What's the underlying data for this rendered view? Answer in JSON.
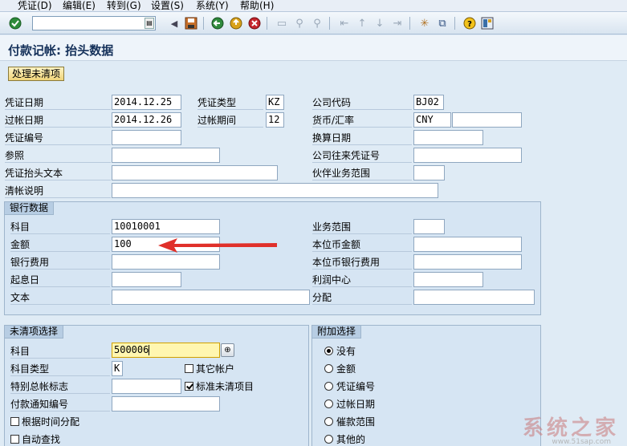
{
  "menu": [
    "凭证(D)",
    "编辑(E)",
    "转到(G)",
    "设置(S)",
    "系统(Y)",
    "帮助(H)"
  ],
  "toolbar": {
    "command_placeholder": "",
    "icons": [
      "enter-icon",
      "save-icon",
      "back-icon",
      "exit-icon",
      "cancel-icon",
      "print-icon",
      "find-icon",
      "find-next-icon",
      "first-page-icon",
      "prev-page-icon",
      "next-page-icon",
      "last-page-icon",
      "new-session-icon",
      "shortcut-icon",
      "help-icon",
      "customize-layout-icon"
    ]
  },
  "title": "付款记帐: 抬头数据",
  "app_button": "处理未清项",
  "header": {
    "doc_date_label": "凭证日期",
    "doc_date": "2014.12.25",
    "doc_type_label": "凭证类型",
    "doc_type": "KZ",
    "company_code_label": "公司代码",
    "company_code": "BJ02",
    "posting_date_label": "过帐日期",
    "posting_date": "2014.12.26",
    "period_label": "过帐期间",
    "period": "12",
    "currency_label": "货币/汇率",
    "currency": "CNY",
    "rate": "",
    "doc_number_label": "凭证编号",
    "doc_number": "",
    "translation_date_label": "换算日期",
    "translation_date": "",
    "reference_label": "参照",
    "reference": "",
    "intercompany_label": "公司往来凭证号",
    "intercompany": "",
    "header_text_label": "凭证抬头文本",
    "header_text": "",
    "trading_partner_label": "伙伴业务范围",
    "trading_partner": "",
    "clearing_text_label": "清帐说明",
    "clearing_text": ""
  },
  "bank": {
    "title": "银行数据",
    "account_label": "科目",
    "account": "10010001",
    "business_area_label": "业务范围",
    "business_area": "",
    "amount_label": "金额",
    "amount": "100",
    "local_amount_label": "本位币金额",
    "local_amount": "",
    "bank_charges_label": "银行费用",
    "bank_charges": "",
    "local_bank_charges_label": "本位币银行费用",
    "local_bank_charges": "",
    "value_date_label": "起息日",
    "value_date": "",
    "profit_center_label": "利润中心",
    "profit_center": "",
    "text_label": "文本",
    "text": "",
    "assignment_label": "分配",
    "assignment": ""
  },
  "open_items": {
    "title": "未清项选择",
    "account_label": "科目",
    "account": "500006",
    "account_type_label": "科目类型",
    "account_type": "K",
    "other_accounts_label": "其它帐户",
    "other_accounts": false,
    "special_gl_label": "特别总帐标志",
    "special_gl": "",
    "standard_oi_label": "标准未清项目",
    "standard_oi": true,
    "payment_advice_label": "付款通知编号",
    "payment_advice": "",
    "distribute_by_age_label": "根据时间分配",
    "distribute_by_age": false,
    "auto_search_label": "自动查找",
    "auto_search": false
  },
  "additional": {
    "title": "附加选择",
    "options": [
      "没有",
      "金额",
      "凭证编号",
      "过帐日期",
      "催款范围",
      "其他的"
    ],
    "selected": "没有"
  },
  "watermark": "系统之家",
  "watermark_url": "www.51sap.com"
}
